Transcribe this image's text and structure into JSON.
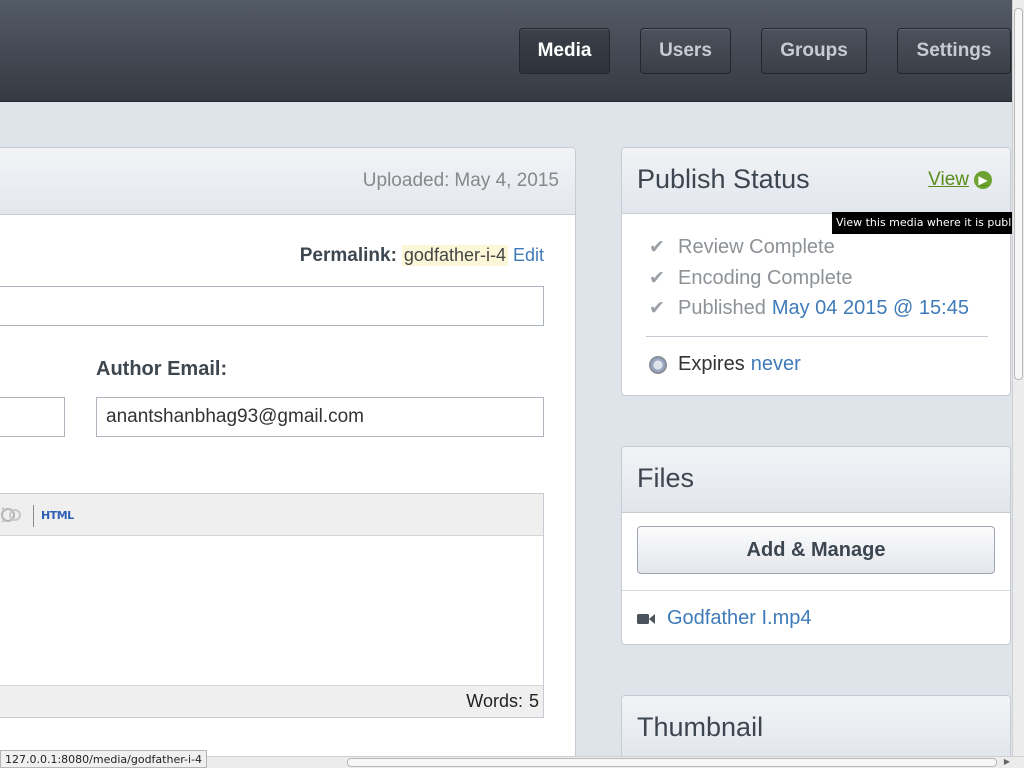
{
  "nav": {
    "items": [
      {
        "label": "Media",
        "active": true
      },
      {
        "label": "Users",
        "active": false
      },
      {
        "label": "Groups",
        "active": false
      },
      {
        "label": "Settings",
        "active": false
      }
    ]
  },
  "main": {
    "uploaded_label": "Uploaded:",
    "uploaded_date": "May 4, 2015",
    "permalink_label": "Permalink:",
    "permalink_slug": "godfather-i-4",
    "permalink_edit": "Edit",
    "title_value": "",
    "author_email_label": "Author Email:",
    "author_name_value": "",
    "author_email_value": "anantshanbhag93@gmail.com",
    "editor": {
      "html_label": "HTML",
      "words_label": "Words:",
      "words_count": "5"
    }
  },
  "publish": {
    "title": "Publish Status",
    "view_label": "View",
    "statuses": [
      "Review Complete",
      "Encoding Complete",
      "Published"
    ],
    "published_date": "May 04 2015 @ 15:45",
    "expires_label": "Expires",
    "expires_value": "never",
    "tooltip": "View this media where it is published"
  },
  "files": {
    "title": "Files",
    "add_button": "Add & Manage",
    "file_name": "Godfather I.mp4"
  },
  "thumbnail": {
    "title": "Thumbnail"
  },
  "browser": {
    "status_url": "127.0.0.1:8080/media/godfather-i-4"
  },
  "icons": {
    "check": "check-icon",
    "clock": "clock-icon",
    "video": "video-camera-icon",
    "arrow": "arrow-right-circle-icon"
  },
  "colors": {
    "link": "#3f7bb8",
    "view_link": "#5a8c1a",
    "header_bg": "#3e434b",
    "page_bg": "#dfe3ea"
  }
}
